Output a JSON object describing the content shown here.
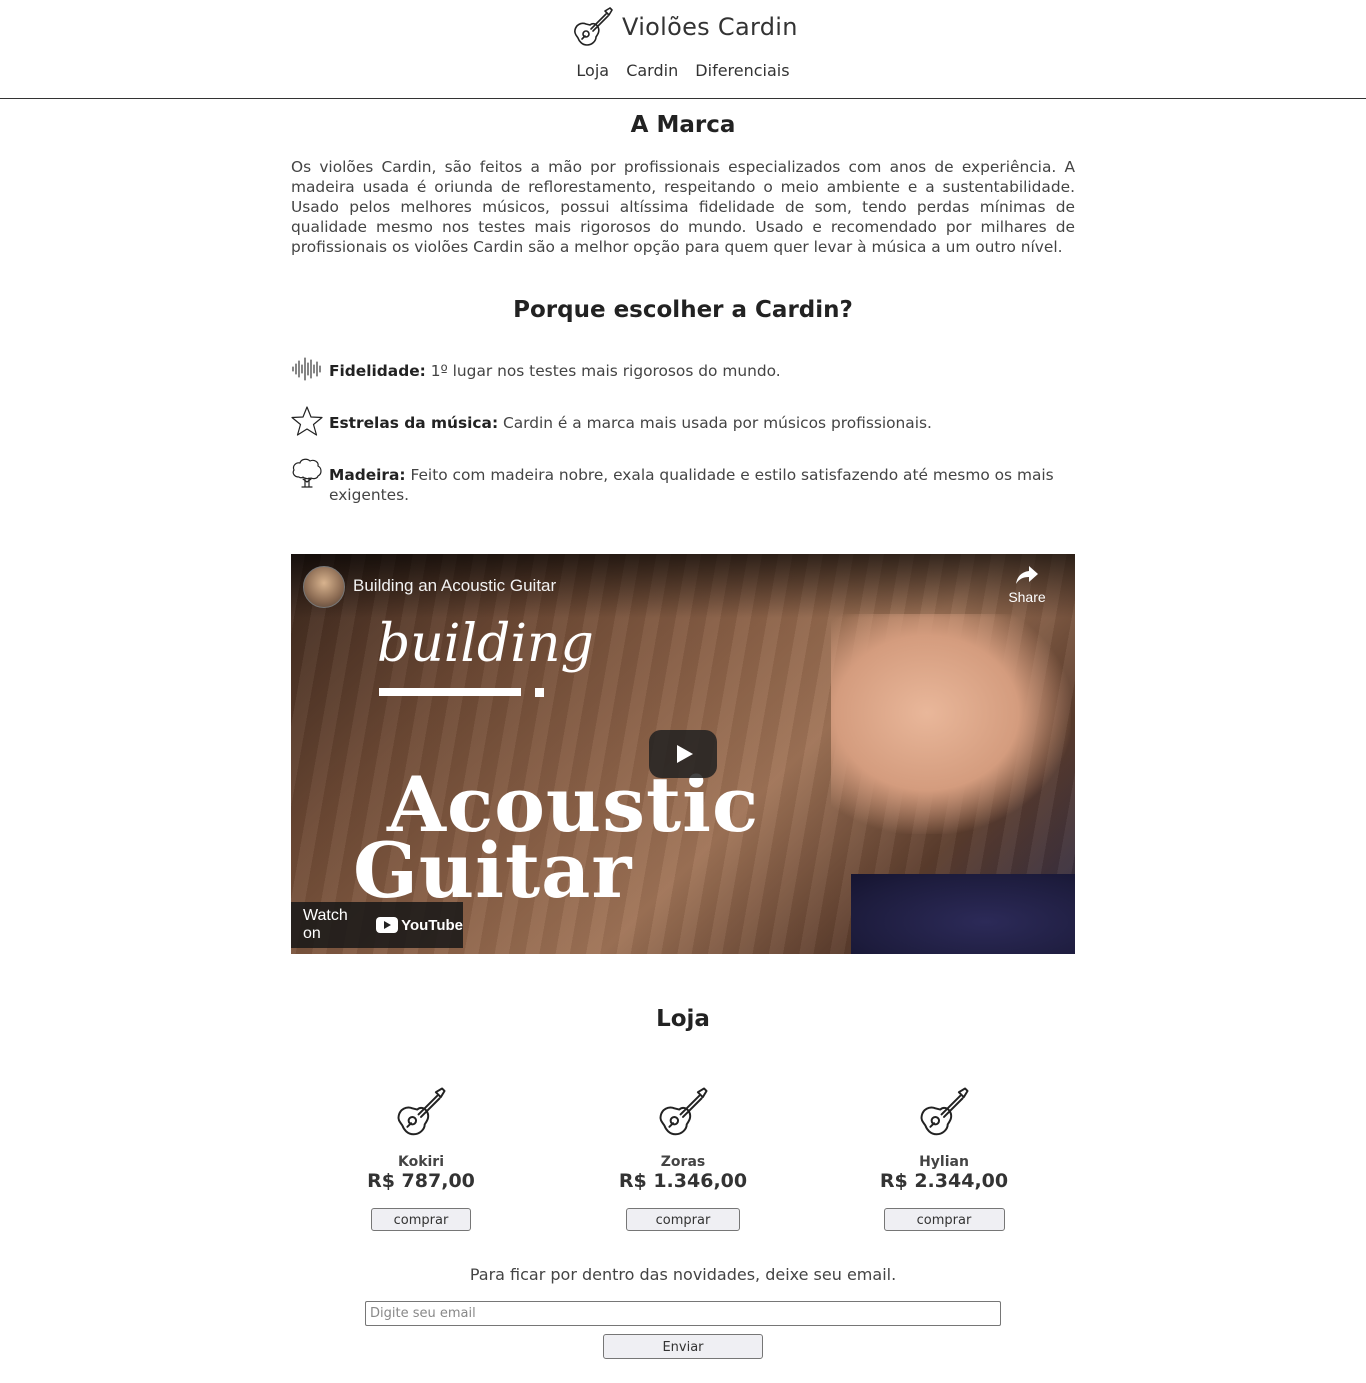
{
  "brand": {
    "title": "Violões Cardin",
    "icon": "guitar-icon"
  },
  "nav": {
    "items": [
      {
        "label": "Loja"
      },
      {
        "label": "Cardin"
      },
      {
        "label": "Diferenciais"
      }
    ]
  },
  "marca": {
    "heading": "A Marca",
    "text": "Os violões Cardin, são feitos a mão por profissionais especializados com anos de experiência. A madeira usada é oriunda de reflorestamento, respeitando o meio ambiente e a sustentabilidade. Usado pelos melhores músicos, possui altíssima fidelidade de som, tendo perdas mínimas de qualidade mesmo nos testes mais rigorosos do mundo. Usado e recomendado por milhares de profissionais os violões Cardin são a melhor opção para quem quer levar à música a um outro nível."
  },
  "porque": {
    "heading": "Porque escolher a Cardin?",
    "features": [
      {
        "icon": "sound-wave-icon",
        "title": "Fidelidade:",
        "text": " 1º lugar nos testes mais rigorosos do mundo."
      },
      {
        "icon": "star-icon",
        "title": "Estrelas da música:",
        "text": " Cardin é a marca mais usada por músicos profissionais."
      },
      {
        "icon": "tree-icon",
        "title": "Madeira:",
        "text": " Feito com madeira nobre, exala qualidade e estilo satisfazendo até mesmo os mais exigentes."
      }
    ]
  },
  "video": {
    "title": "Building an Acoustic Guitar",
    "share_label": "Share",
    "watch_label": "Watch on",
    "youtube_label": "YouTube",
    "overlay_small": "building",
    "overlay_big_1": "Acoustic",
    "overlay_big_2": "Guitar"
  },
  "loja": {
    "heading": "Loja",
    "products": [
      {
        "name": "Kokiri",
        "price": "R$ 787,00",
        "button": "comprar"
      },
      {
        "name": "Zoras",
        "price": "R$ 1.346,00",
        "button": "comprar"
      },
      {
        "name": "Hylian",
        "price": "R$ 2.344,00",
        "button": "comprar"
      }
    ]
  },
  "newsletter": {
    "text": "Para ficar por dentro das novidades, deixe seu email.",
    "placeholder": "Digite seu email",
    "button": "Enviar"
  }
}
